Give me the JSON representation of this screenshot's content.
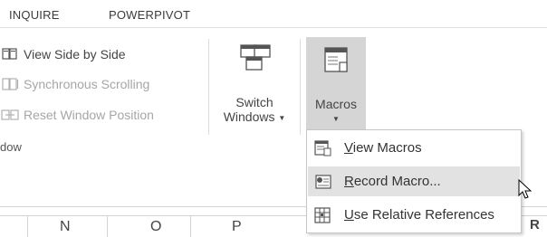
{
  "tabs": [
    {
      "label": "INQUIRE"
    },
    {
      "label": "POWERPIVOT"
    }
  ],
  "window_group": {
    "view_side_by_side": "View Side by Side",
    "synchronous_scrolling": "Synchronous Scrolling",
    "reset_window_position": "Reset Window Position",
    "switch_windows_line1": "Switch",
    "switch_windows_line2": "Windows",
    "group_label": "dow"
  },
  "macros": {
    "label": "Macros"
  },
  "macros_menu": {
    "items": [
      {
        "accesskey": "V",
        "rest": "iew Macros"
      },
      {
        "accesskey": "R",
        "rest": "ecord Macro..."
      },
      {
        "accesskey": "U",
        "rest": "se Relative References"
      }
    ],
    "hover_index": 1
  },
  "column_headers": [
    "N",
    "O",
    "P",
    "R"
  ],
  "colors": {
    "macros_pressed_bg": "#d5d5d5",
    "menu_hover_bg": "#e2e2e2",
    "disabled_text": "#a6a6a6"
  }
}
